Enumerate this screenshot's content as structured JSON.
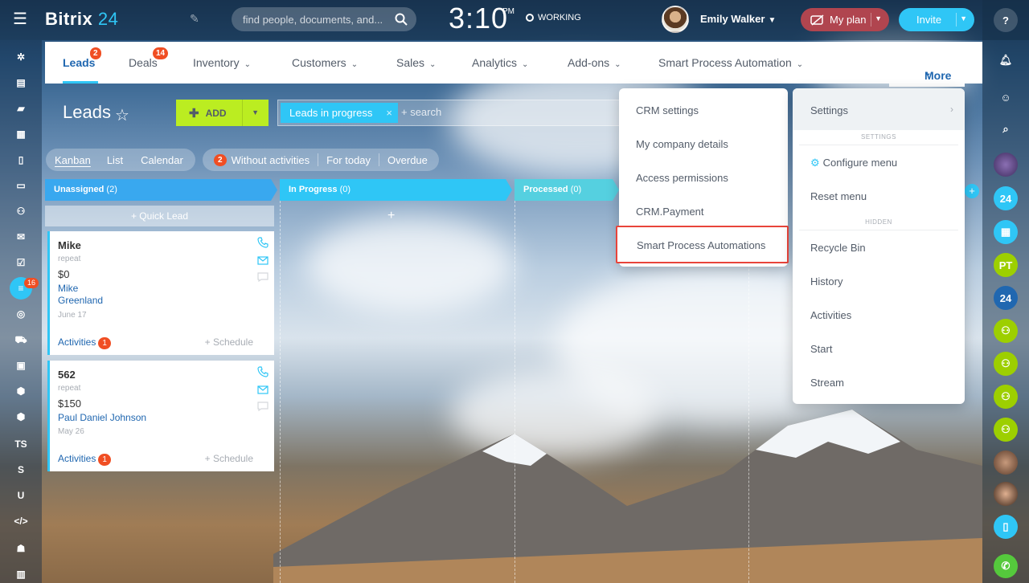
{
  "header": {
    "logo_main": "Bitrix",
    "logo_num": "24",
    "search_placeholder": "find people, documents, and...",
    "clock": "3:10",
    "ampm": "PM",
    "work_status": "WORKING",
    "user_name": "Emily Walker",
    "plan_label": "My plan",
    "invite_label": "Invite"
  },
  "nav": {
    "items": [
      {
        "label": "Leads",
        "badge": "2"
      },
      {
        "label": "Deals",
        "badge": "14"
      },
      {
        "label": "Inventory"
      },
      {
        "label": "Customers"
      },
      {
        "label": "Sales"
      },
      {
        "label": "Analytics"
      },
      {
        "label": "Add-ons"
      },
      {
        "label": "Smart Process Automation"
      }
    ],
    "more_label": "More"
  },
  "page": {
    "title": "Leads",
    "add_label": "ADD",
    "filter_chip": "Leads in progress",
    "filter_search": "+ search",
    "views": [
      "Kanban",
      "List",
      "Calendar"
    ],
    "counters": {
      "without_activities_count": "2",
      "without_activities": "Without activities",
      "for_today": "For today",
      "overdue": "Overdue"
    }
  },
  "kanban": {
    "columns": [
      {
        "name": "Unassigned",
        "count": "(2)",
        "color": "#39a8ef"
      },
      {
        "name": "In Progress",
        "count": "(0)",
        "color": "#2fc6f6"
      },
      {
        "name": "Processed",
        "count": "(0)",
        "color": "#55d0e0"
      }
    ],
    "quick_lead": "+ Quick Lead",
    "cards": [
      {
        "title": "Mike",
        "sub": "repeat",
        "amount": "$0",
        "client_line1": "Mike",
        "client_line2": "Greenland",
        "date": "June 17",
        "activities": "Activities",
        "activities_count": "1",
        "schedule": "+ Schedule"
      },
      {
        "title": "562",
        "sub": "repeat",
        "amount": "$150",
        "client_line1": "Paul Daniel Johnson",
        "date": "May 26",
        "activities": "Activities",
        "activities_count": "1",
        "schedule": "+ Schedule"
      }
    ]
  },
  "more_menu": {
    "items": [
      "CRM settings",
      "My company details",
      "Access permissions",
      "CRM.Payment",
      "Smart Process Automations"
    ]
  },
  "settings_menu": {
    "title": "Settings",
    "section_settings": "SETTINGS",
    "configure": "Configure menu",
    "reset": "Reset menu",
    "section_hidden": "HIDDEN",
    "hidden_items": [
      "Recycle Bin",
      "History",
      "Activities",
      "Start",
      "Stream"
    ]
  },
  "left_rail": {
    "badge": "16",
    "labels": [
      "TS",
      "S",
      "U"
    ]
  },
  "right_rail": {
    "labels": [
      "24",
      "PT",
      "24"
    ]
  },
  "colors": {
    "accent": "#2fc6f6",
    "link": "#2067b0",
    "add_green": "#bbed21",
    "badge_red": "#f04e23",
    "plan_red": "#b0454f",
    "highlight_red": "#e8443a"
  }
}
